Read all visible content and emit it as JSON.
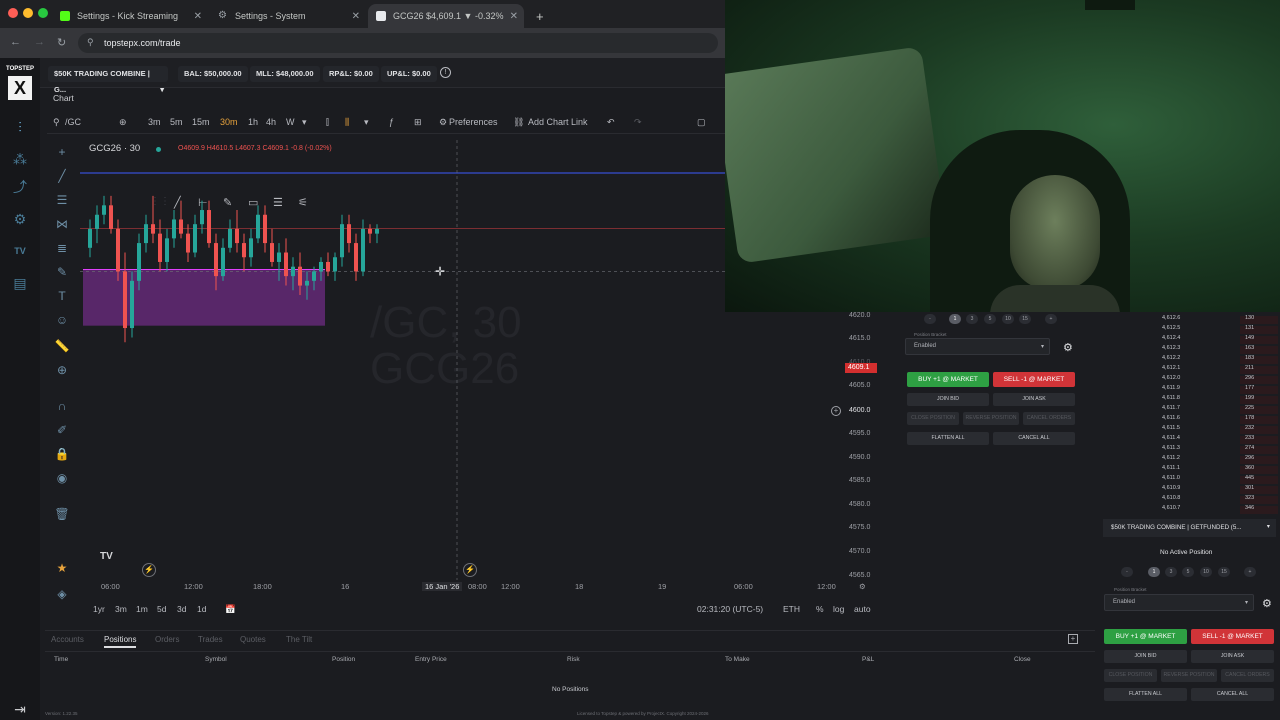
{
  "browser": {
    "tabs": [
      {
        "title": "Settings - Kick Streaming",
        "icon_color": "#53fc18"
      },
      {
        "title": "Settings - System",
        "icon_color": "#9aa0a6"
      },
      {
        "title": "GCG26 $4,609.1 ▼ -0.32%",
        "icon_color": "#e8eaed"
      }
    ],
    "new_tab": "+",
    "url": "topstepx.com/trade"
  },
  "brand": {
    "line1": "TOPSTEP",
    "line2": "X"
  },
  "account_bar": {
    "account": "$50K TRADING COMBINE | G...",
    "bal": "BAL: $50,000.00",
    "mll": "MLL: $48,000.00",
    "rpl": "RP&L: $0.00",
    "upl": "UP&L: $0.00"
  },
  "chart_tab": "Chart",
  "toolbar": {
    "symbol": "/GC",
    "intervals": [
      "3m",
      "5m",
      "15m",
      "30m",
      "1h",
      "4h",
      "W"
    ],
    "active_interval": "30m",
    "preferences": "Preferences",
    "add_chart_link": "Add Chart Link"
  },
  "legend": {
    "symbol": "GCG26 · 30",
    "ohlc": "O4609.9 H4610.5 L4607.3 C4609.1 -0.8 (-0.02%)"
  },
  "watermark": {
    "line1": "/GC, 30",
    "line2": "GCG26"
  },
  "chart_data": {
    "type": "candlestick",
    "current_price": "4609.1",
    "crosshair_price": "4600.0",
    "price_ticks": [
      "4620.0",
      "4615.0",
      "4610.0",
      "4605.0",
      "4600.0",
      "4595.0",
      "4590.0",
      "4585.0",
      "4580.0",
      "4575.0",
      "4570.0",
      "4565.0"
    ],
    "time_ticks": [
      "06:00",
      "12:00",
      "18:00",
      "16",
      "16 Jan '26",
      "08:00",
      "12:00",
      "18",
      "19",
      "06:00",
      "12:00"
    ],
    "colors": {
      "up": "#26a69a",
      "down": "#ef5350",
      "zone": "#a335c4",
      "hline": "#3d5afe"
    }
  },
  "range_bar": {
    "ranges": [
      "1yr",
      "3m",
      "1m",
      "5d",
      "3d",
      "1d"
    ],
    "clock": "02:31:20 (UTC-5)",
    "session": "ETH",
    "percent": "%",
    "log": "log",
    "auto": "auto"
  },
  "bottom_panel": {
    "tabs": [
      "Accounts",
      "Positions",
      "Orders",
      "Trades",
      "Quotes",
      "The Tilt"
    ],
    "active_tab": "Positions",
    "columns": [
      "Time",
      "Symbol",
      "Position",
      "Entry Price",
      "Risk",
      "To Make",
      "P&L",
      "Close"
    ],
    "empty": "No Positions"
  },
  "footer": {
    "version": "Version: 1.22.35",
    "license": "Licensed to Topstep & powered by ProjectX. Copyright 2024-2026"
  },
  "order_panel_1": {
    "qty": [
      "-",
      "1",
      "3",
      "5",
      "10",
      "15",
      "+"
    ],
    "bracket_label": "Position Bracket",
    "bracket_value": "Enabled",
    "buy": "BUY +1 @ MARKET",
    "sell": "SELL -1 @ MARKET",
    "join_bid": "JOIN BID",
    "join_ask": "JOIN ASK",
    "close_position": "CLOSE POSITION",
    "reverse_position": "REVERSE POSITION",
    "cancel_orders": "CANCEL ORDERS",
    "flatten_all": "FLATTEN ALL",
    "cancel_all": "CANCEL ALL"
  },
  "dom": {
    "rows": [
      {
        "price": "4,612.6",
        "qty": "130"
      },
      {
        "price": "4,612.5",
        "qty": "131"
      },
      {
        "price": "4,612.4",
        "qty": "149"
      },
      {
        "price": "4,612.3",
        "qty": "163"
      },
      {
        "price": "4,612.2",
        "qty": "183"
      },
      {
        "price": "4,612.1",
        "qty": "211"
      },
      {
        "price": "4,612.0",
        "qty": "296"
      },
      {
        "price": "4,611.9",
        "qty": "177"
      },
      {
        "price": "4,611.8",
        "qty": "199"
      },
      {
        "price": "4,611.7",
        "qty": "225"
      },
      {
        "price": "4,611.6",
        "qty": "178"
      },
      {
        "price": "4,611.5",
        "qty": "232"
      },
      {
        "price": "4,611.4",
        "qty": "233"
      },
      {
        "price": "4,611.3",
        "qty": "274"
      },
      {
        "price": "4,611.2",
        "qty": "296"
      },
      {
        "price": "4,611.1",
        "qty": "360"
      },
      {
        "price": "4,611.0",
        "qty": "445"
      },
      {
        "price": "4,610.9",
        "qty": "301"
      },
      {
        "price": "4,610.8",
        "qty": "323"
      },
      {
        "price": "4,610.7",
        "qty": "346"
      }
    ]
  },
  "account_select": "$50K TRADING COMBINE | GETFUNDED (5...",
  "order_panel_2": {
    "no_position": "No Active Position",
    "qty": [
      "-",
      "1",
      "3",
      "5",
      "10",
      "15",
      "+"
    ],
    "bracket_label": "Position Bracket",
    "bracket_value": "Enabled",
    "buy": "BUY +1 @ MARKET",
    "sell": "SELL -1 @ MARKET",
    "join_bid": "JOIN BID",
    "join_ask": "JOIN ASK",
    "close_position": "CLOSE POSITION",
    "reverse_position": "REVERSE POSITION",
    "cancel_orders": "CANCEL ORDERS",
    "flatten_all": "FLATTEN ALL",
    "cancel_all": "CANCEL ALL"
  }
}
